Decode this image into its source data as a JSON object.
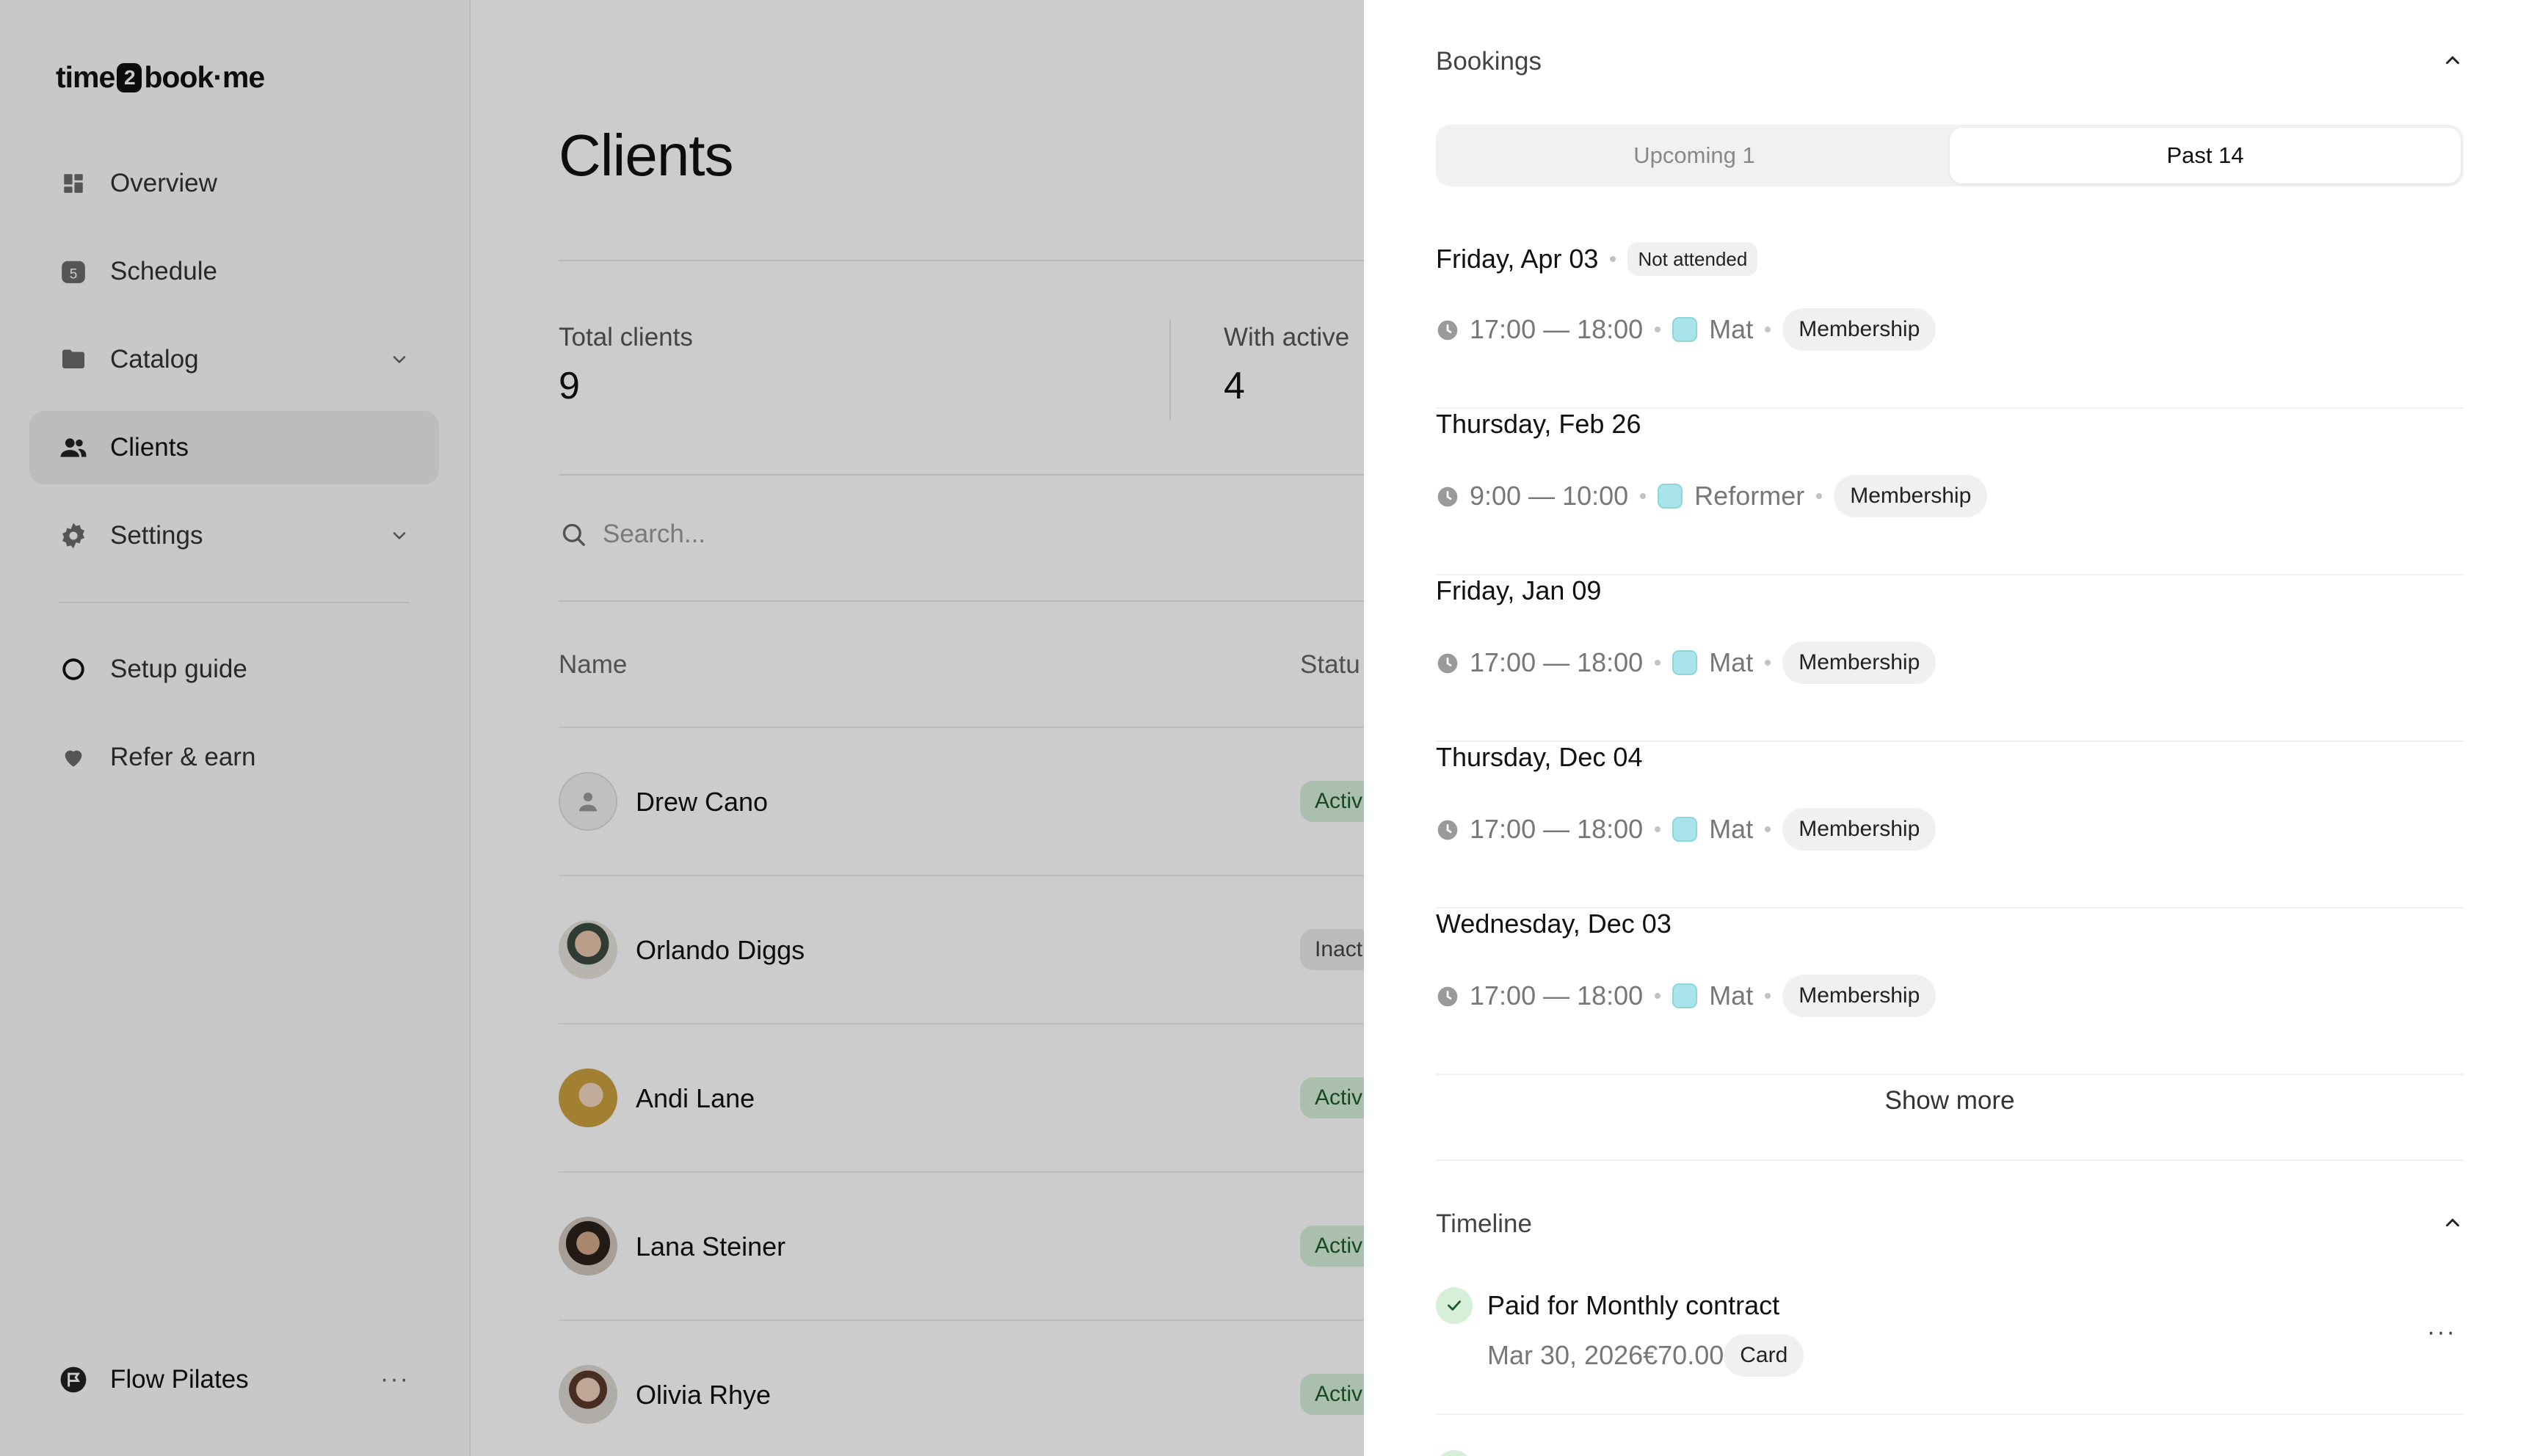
{
  "brand": {
    "logo_left": "time",
    "logo_mid": "2",
    "logo_right": "book·me"
  },
  "sidebar": {
    "items": [
      {
        "label": "Overview",
        "icon": "grid-icon"
      },
      {
        "label": "Schedule",
        "icon": "calendar-icon",
        "icon_text": "5"
      },
      {
        "label": "Catalog",
        "icon": "folder-icon",
        "has_chevron": true
      },
      {
        "label": "Clients",
        "icon": "users-icon",
        "active": true
      },
      {
        "label": "Settings",
        "icon": "gear-icon",
        "has_chevron": true
      }
    ],
    "secondary": [
      {
        "label": "Setup guide",
        "icon": "circle-icon"
      },
      {
        "label": "Refer & earn",
        "icon": "heart-icon"
      }
    ],
    "workspace": {
      "label": "Flow Pilates",
      "more": "···"
    }
  },
  "main": {
    "title": "Clients",
    "stats": [
      {
        "label": "Total clients",
        "value": "9"
      },
      {
        "label": "With active",
        "value": "4"
      }
    ],
    "search": {
      "placeholder": "Search..."
    },
    "columns": {
      "name": "Name",
      "status": "Statu"
    },
    "rows": [
      {
        "name": "Drew Cano",
        "status": "Activ",
        "state": "active"
      },
      {
        "name": "Orlando Diggs",
        "status": "Inact",
        "state": "inactive"
      },
      {
        "name": "Andi Lane",
        "status": "Activ",
        "state": "active"
      },
      {
        "name": "Lana Steiner",
        "status": "Activ",
        "state": "active"
      },
      {
        "name": "Olivia Rhye",
        "status": "Activ",
        "state": "active"
      }
    ]
  },
  "drawer": {
    "bookings": {
      "title": "Bookings",
      "tabs": [
        {
          "label": "Upcoming 1",
          "selected": false
        },
        {
          "label": "Past 14",
          "selected": true
        }
      ],
      "items": [
        {
          "date": "Friday, Apr 03",
          "status": "Not attended",
          "time": "17:00 — 18:00",
          "class": "Mat",
          "payment": "Membership"
        },
        {
          "date": "Thursday, Feb 26",
          "status": "",
          "time": "9:00 — 10:00",
          "class": "Reformer",
          "payment": "Membership"
        },
        {
          "date": "Friday, Jan 09",
          "status": "",
          "time": "17:00 — 18:00",
          "class": "Mat",
          "payment": "Membership"
        },
        {
          "date": "Thursday, Dec 04",
          "status": "",
          "time": "17:00 — 18:00",
          "class": "Mat",
          "payment": "Membership"
        },
        {
          "date": "Wednesday, Dec 03",
          "status": "",
          "time": "17:00 — 18:00",
          "class": "Mat",
          "payment": "Membership"
        }
      ],
      "show_more": "Show more"
    },
    "timeline": {
      "title": "Timeline",
      "items": [
        {
          "title": "Paid for Monthly contract",
          "date": "Mar 30, 2026",
          "amount": "€70.00",
          "method": "Card",
          "more": "···"
        }
      ]
    }
  },
  "colors": {
    "accent_active_bg": "#d5efd9",
    "class_swatch": "#a8e4ea",
    "overlay": "rgba(0,0,0,0.2)"
  }
}
